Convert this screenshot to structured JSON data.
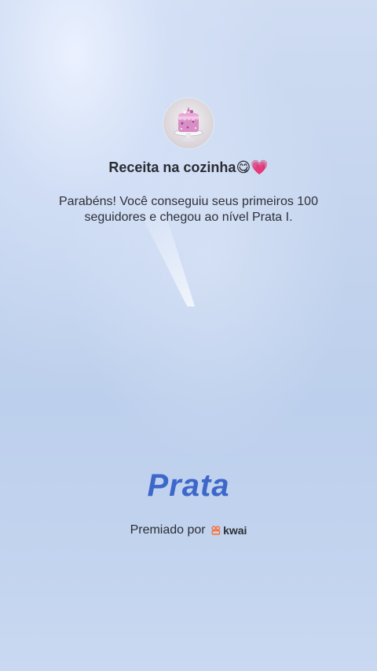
{
  "profile": {
    "name": "Receita na cozinha",
    "name_emojis": "😋💗",
    "avatar": "cake-avatar"
  },
  "congrats": {
    "message": "Parabéns! Você conseguiu seus primeiros 100 seguidores e chegou ao nível Prata I."
  },
  "level": {
    "label": "Prata",
    "color": "#3d67c9"
  },
  "award": {
    "prefix": "Premiado por",
    "brand": "kwai",
    "brand_icon": "kwai-logo-icon",
    "brand_color": "#ff6a2c"
  }
}
